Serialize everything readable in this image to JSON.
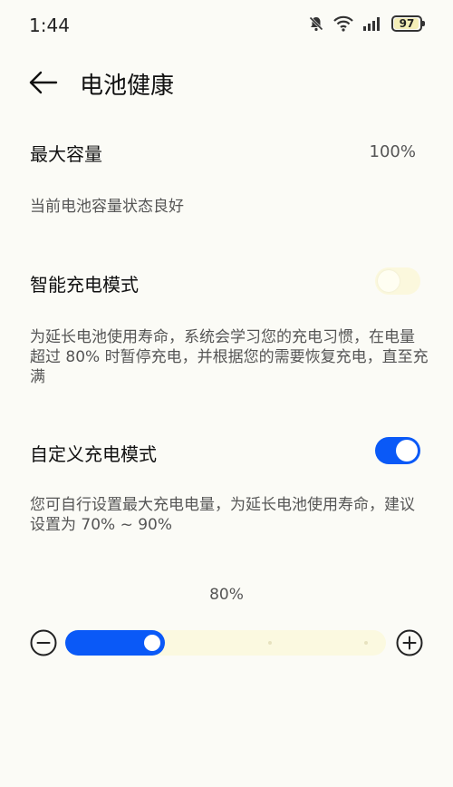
{
  "status_bar": {
    "time": "1:44",
    "battery": "97",
    "icons": [
      "mute-bell-icon",
      "wifi-icon",
      "signal-icon",
      "battery-icon"
    ]
  },
  "header": {
    "back_icon": "arrow-left-icon",
    "title": "电池健康"
  },
  "capacity": {
    "title": "最大容量",
    "value": "100%",
    "description": "当前电池容量状态良好"
  },
  "smart_charging": {
    "title": "智能充电模式",
    "enabled": false,
    "description": "为延长电池使用寿命，系统会学习您的充电习惯，在电量超过 80% 时暂停充电，并根据您的需要恢复充电，直至充满"
  },
  "custom_charging": {
    "title": "自定义充电模式",
    "enabled": true,
    "description": "您可自行设置最大充电电量，为延长电池使用寿命，建议设置为 70% ~ 90%"
  },
  "limit_slider": {
    "value_label": "80%",
    "value": 80,
    "steps": [
      70,
      80,
      90,
      100
    ],
    "minus_icon": "minus-circle-icon",
    "plus_icon": "plus-circle-icon"
  },
  "colors": {
    "accent": "#0a59f7",
    "background": "#fbfbf6",
    "toggle_off": "#fbf8dd"
  }
}
